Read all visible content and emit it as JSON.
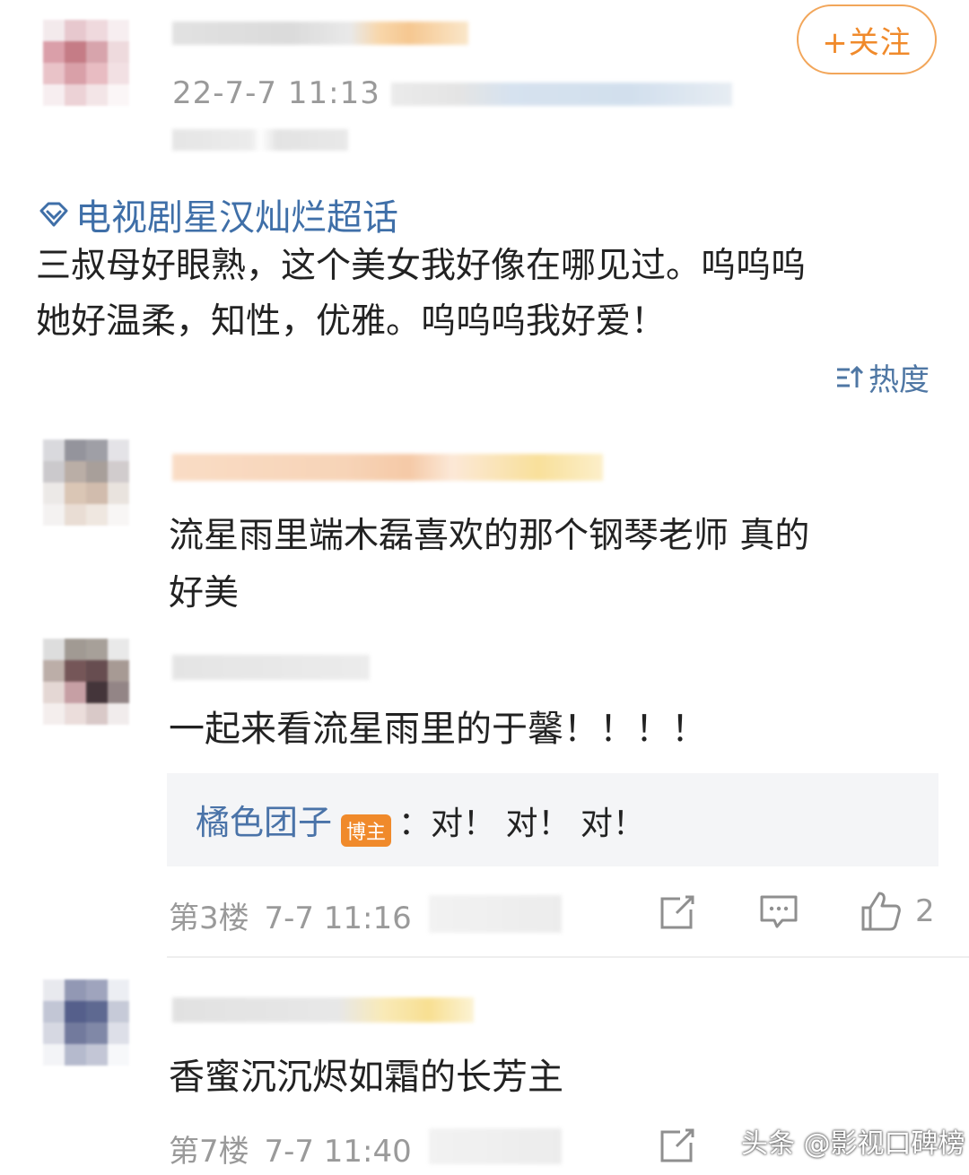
{
  "post": {
    "follow_label": "+关注",
    "timestamp": "22-7-7 11:13",
    "topic_icon": "diamond-topic-icon",
    "topic": "电视剧星汉灿烂超话",
    "text_line1": "三叔母好眼熟，这个美女我好像在哪见过。呜呜呜",
    "text_line2": "她好温柔，知性，优雅。呜呜呜我好爱！",
    "sort_label": "热度"
  },
  "comments": [
    {
      "text_line1": "流星雨里端木磊喜欢的那个钢琴老师 真的",
      "text_line2": "好美"
    },
    {
      "text": "一起来看流星雨里的于馨！！！！",
      "reply": {
        "author": "橘色团子",
        "badge": "博主",
        "text": "：对！ 对！ 对！"
      },
      "floor_label": "第3楼",
      "time": "7-7 11:16",
      "like_count": "2"
    },
    {
      "text": "香蜜沉沉烬如霜的长芳主",
      "floor_label": "第7楼",
      "time": "7-7 11:40"
    }
  ],
  "watermark": "头条 @影视口碑榜",
  "colors": {
    "link_blue": "#3f6fa8",
    "accent_orange": "#f08a2b",
    "meta_gray": "#9a9a9a"
  }
}
